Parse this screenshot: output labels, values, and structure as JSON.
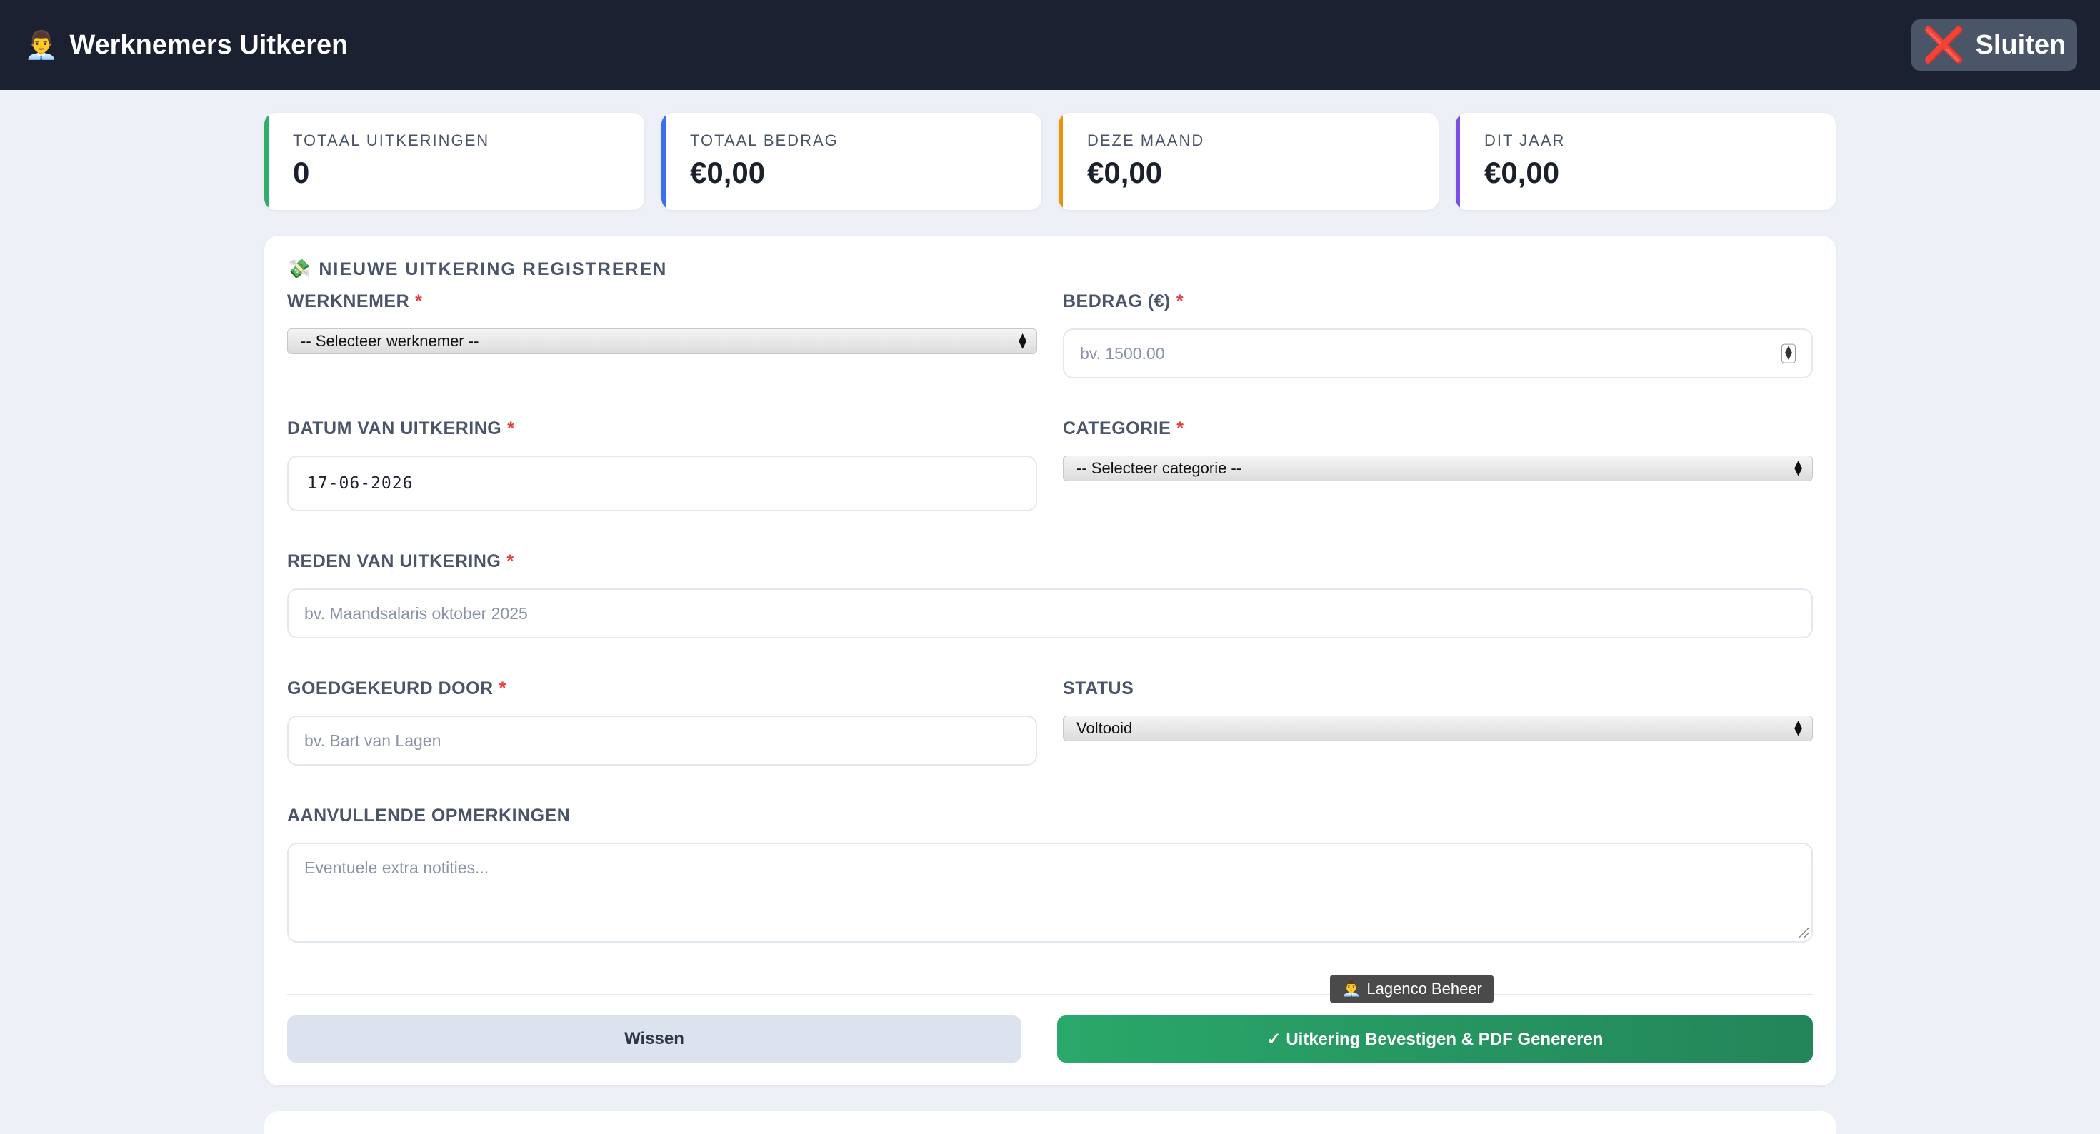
{
  "header": {
    "icon": "office-worker-icon",
    "icon_glyph": "👨‍💼",
    "title": "Werknemers Uitkeren",
    "close_icon_glyph": "❌",
    "close_label": "Sluiten"
  },
  "stats": [
    {
      "label": "TOTAAL UITKERINGEN",
      "value": "0",
      "accent": "#2fae67"
    },
    {
      "label": "TOTAAL BEDRAG",
      "value": "€0,00",
      "accent": "#3b6fe8"
    },
    {
      "label": "DEZE MAAND",
      "value": "€0,00",
      "accent": "#e8940a"
    },
    {
      "label": "DIT JAAR",
      "value": "€0,00",
      "accent": "#7b4fe0"
    }
  ],
  "form": {
    "section_icon_glyph": "💸",
    "section_title": "NIEUWE UITKERING REGISTREREN",
    "required_mark": "*",
    "werknemer": {
      "label": "WERKNEMER",
      "selected": "-- Selecteer werknemer --"
    },
    "bedrag": {
      "label": "BEDRAG (€)",
      "placeholder": "bv. 1500.00"
    },
    "datum": {
      "label": "DATUM VAN UITKERING",
      "value": "17-06-2026"
    },
    "categorie": {
      "label": "CATEGORIE",
      "selected": "-- Selecteer categorie --"
    },
    "reden": {
      "label": "REDEN VAN UITKERING",
      "placeholder": "bv. Maandsalaris oktober 2025"
    },
    "goedgekeurd": {
      "label": "GOEDGEKEURD DOOR",
      "placeholder": "bv. Bart van Lagen"
    },
    "status": {
      "label": "STATUS",
      "selected": "Voltooid"
    },
    "opmerkingen": {
      "label": "AANVULLENDE OPMERKINGEN",
      "placeholder": "Eventuele extra notities..."
    },
    "clear_label": "Wissen",
    "confirm_label": "✓ Uitkering Bevestigen & PDF Genereren"
  },
  "tooltip": {
    "icon_glyph": "👨‍💼",
    "text": "Lagenco Beheer"
  },
  "colors": {
    "topbar": "#1b2130",
    "background": "#edf0f7",
    "confirm": "#28a064",
    "required": "#e53e3e"
  }
}
